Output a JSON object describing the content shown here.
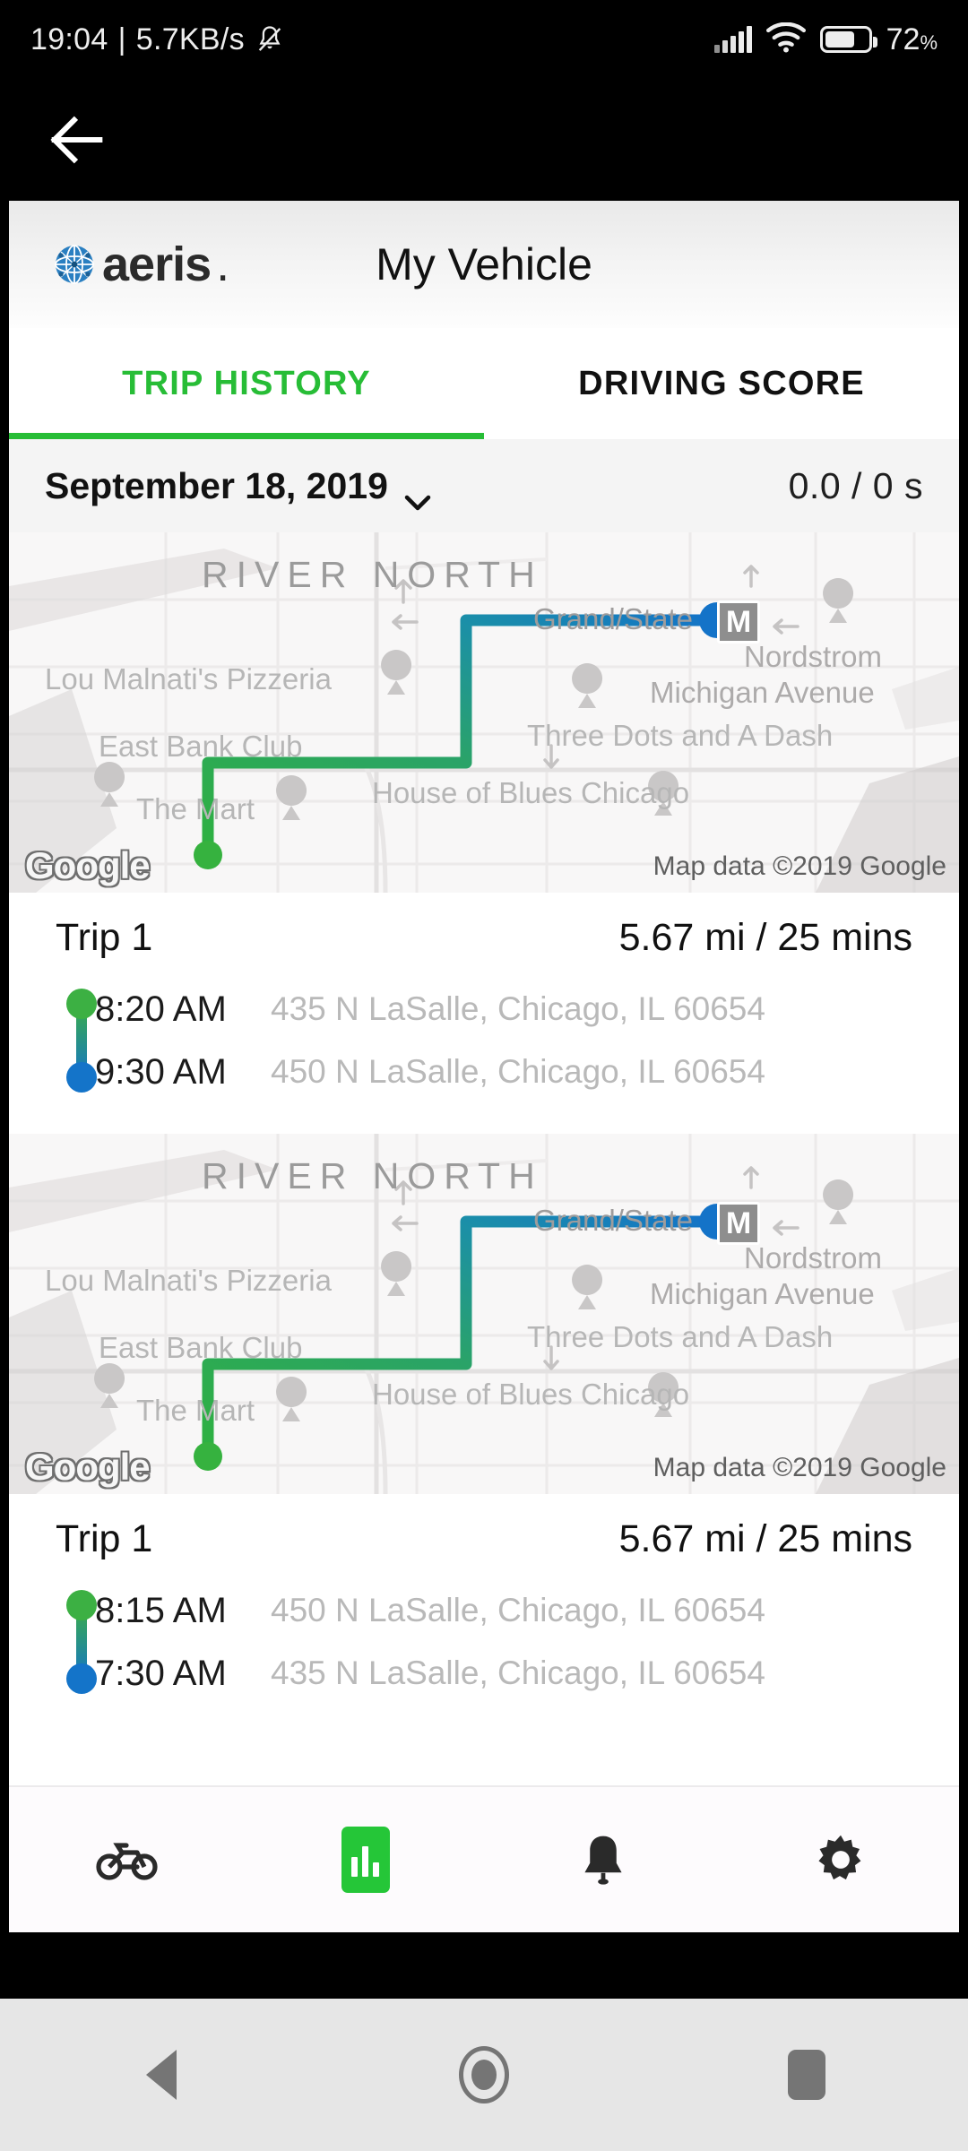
{
  "status_bar": {
    "time": "19:04",
    "separator": "|",
    "network_speed": "5.7KB/s",
    "mute_icon": "bell-muted-icon",
    "signal_icon": "signal-bars-icon",
    "wifi_icon": "wifi-icon",
    "battery_icon": "battery-icon",
    "battery_percent": "72",
    "battery_percent_symbol": "%"
  },
  "topnav": {
    "back_icon": "back-arrow-icon"
  },
  "appbar": {
    "logo_text": "aeris",
    "logo_dot": ".",
    "logo_mark": "aeris-globe-icon",
    "title": "My Vehicle"
  },
  "tabs": [
    {
      "label": "TRIP HISTORY",
      "active": true
    },
    {
      "label": "DRIVING SCORE",
      "active": false
    }
  ],
  "date_row": {
    "date": "September 18, 2019",
    "chevron_icon": "chevron-down-icon",
    "stat": "0.0  / 0 s"
  },
  "map": {
    "area_label": "RIVER NORTH",
    "pois": [
      "Lou Malnati's Pizzeria",
      "East Bank Club",
      "The Mart",
      "House of Blues Chicago",
      "Three Dots and A Dash",
      "Nordstrom",
      "Michigan Avenue",
      "Grand/State"
    ],
    "transit_badge": "M",
    "watermark": "Google",
    "attribution": "Map data ©2019 Google",
    "route_start_color": "#33b13f",
    "route_end_color": "#1473c8"
  },
  "trips": [
    {
      "title": "Trip 1",
      "stats": "5.67 mi / 25 mins",
      "legs": [
        {
          "time": "8:20 AM",
          "address": "435 N LaSalle, Chicago, IL 60654"
        },
        {
          "time": "9:30 AM",
          "address": "450 N LaSalle, Chicago, IL 60654"
        }
      ]
    },
    {
      "title": "Trip 1",
      "stats": "5.67 mi / 25 mins",
      "legs": [
        {
          "time": "8:15 AM",
          "address": "450 N LaSalle, Chicago, IL 60654"
        },
        {
          "time": "7:30 AM",
          "address": "435 N LaSalle, Chicago, IL 60654"
        }
      ]
    }
  ],
  "bottom_nav": [
    {
      "icon": "scooter-icon",
      "active": false
    },
    {
      "icon": "bar-chart-icon",
      "active": true
    },
    {
      "icon": "bell-icon",
      "active": false
    },
    {
      "icon": "gear-icon",
      "active": false
    }
  ],
  "system_nav": {
    "back_icon": "system-back-icon",
    "home_icon": "system-home-icon",
    "recents_icon": "system-recents-icon"
  },
  "colors": {
    "accent_green": "#27bd36",
    "route_blue": "#1473c8",
    "logo_blue": "#2a7fc1"
  }
}
